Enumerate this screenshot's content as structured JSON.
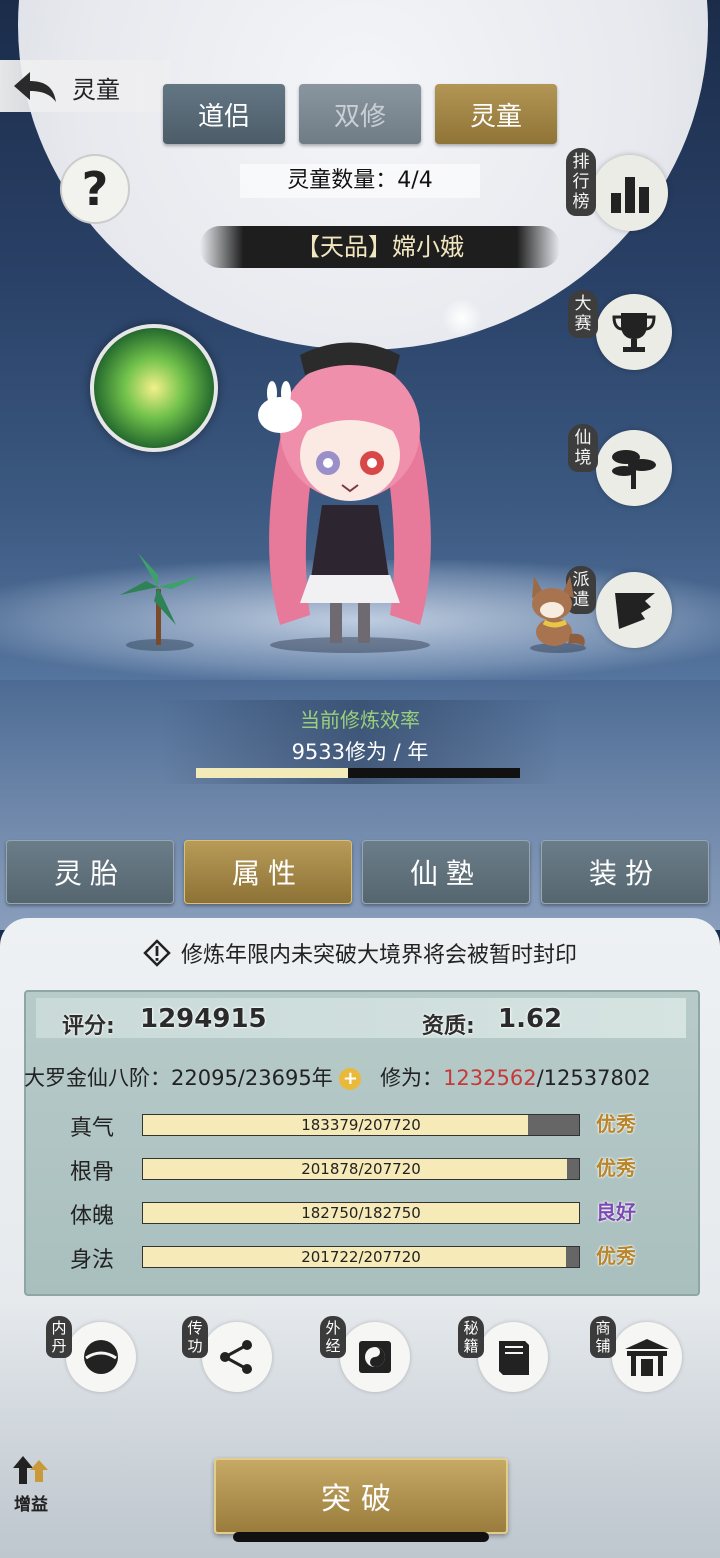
{
  "header": {
    "back_title": "灵童"
  },
  "top_tabs": [
    {
      "label": "道侣",
      "state": "normal"
    },
    {
      "label": "双修",
      "state": "disabled"
    },
    {
      "label": "灵童",
      "state": "selected"
    }
  ],
  "help_icon": "question-mark",
  "count_label": "灵童数量：4/4",
  "companion_name": "【天品】嫦小娥",
  "side_menu": [
    {
      "label": "排行榜",
      "icon": "ranking-bars-icon"
    },
    {
      "label": "大赛",
      "icon": "trophy-icon"
    },
    {
      "label": "仙境",
      "icon": "pine-tree-icon"
    },
    {
      "label": "派遣",
      "icon": "flag-icon"
    }
  ],
  "efficiency": {
    "label": "当前修炼效率",
    "value": "9533修为 / 年",
    "progress": 0.47
  },
  "main_tabs": [
    {
      "label": "灵胎",
      "state": "normal"
    },
    {
      "label": "属性",
      "state": "selected"
    },
    {
      "label": "仙塾",
      "state": "normal"
    },
    {
      "label": "装扮",
      "state": "normal"
    }
  ],
  "warning": "修炼年限内未突破大境界将会被暂时封印",
  "stats": {
    "score_label": "评分:",
    "score_value": "1294915",
    "aptitude_label": "资质:",
    "aptitude_value": "1.62",
    "realm_label": "大罗金仙八阶：",
    "realm_years": "22095/23695年",
    "cultivation_label": "修为：",
    "cultivation_current": "1232562",
    "cultivation_total": "/12537802",
    "attributes": [
      {
        "name": "真气",
        "value": "183379/207720",
        "ratio": 0.883,
        "grade": "优秀",
        "grade_color": "#b8862c"
      },
      {
        "name": "根骨",
        "value": "201878/207720",
        "ratio": 0.972,
        "grade": "优秀",
        "grade_color": "#b8862c"
      },
      {
        "name": "体魄",
        "value": "182750/182750",
        "ratio": 1.0,
        "grade": "良好",
        "grade_color": "#7c4ab3"
      },
      {
        "name": "身法",
        "value": "201722/207720",
        "ratio": 0.971,
        "grade": "优秀",
        "grade_color": "#b8862c"
      }
    ]
  },
  "bottom_menu": [
    {
      "label": "内丹",
      "icon": "inner-pill-icon"
    },
    {
      "label": "传功",
      "icon": "share-nodes-icon"
    },
    {
      "label": "外经",
      "icon": "yin-yang-scroll-icon"
    },
    {
      "label": "秘籍",
      "icon": "book-icon"
    },
    {
      "label": "商铺",
      "icon": "pavilion-icon"
    }
  ],
  "boost_label": "增益",
  "breakthrough_label": "突破"
}
